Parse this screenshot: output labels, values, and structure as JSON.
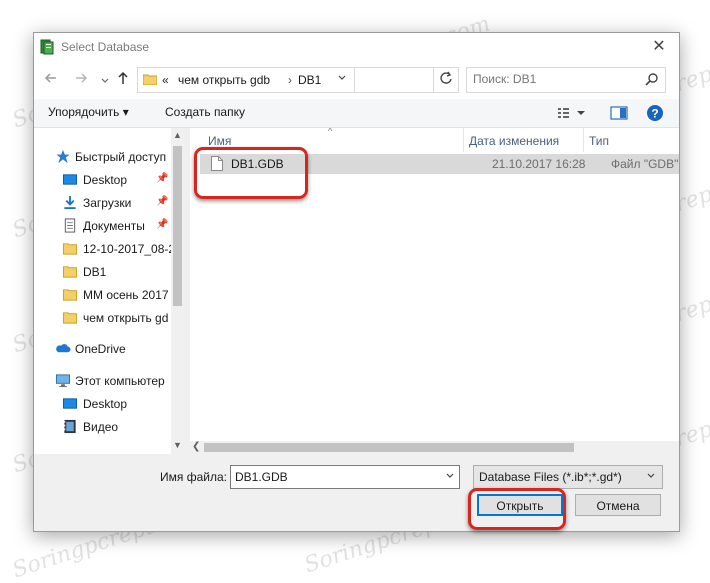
{
  "window": {
    "title": "Select Database",
    "close_glyph": "✕"
  },
  "address": {
    "overflow": "«",
    "crumbs": [
      "чем открыть gdb",
      "DB1"
    ],
    "separator": "›",
    "search_placeholder": "Поиск: DB1"
  },
  "toolbar": {
    "organize_label": "Упорядочить ▾",
    "new_folder_label": "Создать папку"
  },
  "nav": {
    "quick_access": "Быстрый доступ",
    "desktop": "Desktop",
    "downloads": "Загрузки",
    "documents": "Документы",
    "folder1": "12-10-2017_08-2",
    "folder2": "DB1",
    "folder3": "ММ осень 2017",
    "folder4": "чем открыть gd",
    "onedrive": "OneDrive",
    "this_pc": "Этот компьютер",
    "pc_desktop": "Desktop",
    "video": "Видео"
  },
  "columns": {
    "name": "Имя",
    "date": "Дата изменения",
    "type": "Тип"
  },
  "files": [
    {
      "name": "DB1.GDB",
      "date": "21.10.2017 16:28",
      "type": "Файл \"GDB\""
    }
  ],
  "bottom": {
    "filename_label": "Имя файла:",
    "filename_value": "DB1.GDB",
    "filter_value": "Database Files (*.ib*;*.gd*)",
    "open_label": "Открыть",
    "cancel_label": "Отмена"
  },
  "watermark": "Soringpcrepair.com",
  "colors": {
    "accent": "#0078d7",
    "highlight": "#d9251c",
    "selection": "#d9d9d9"
  },
  "icons": [
    "app-icon",
    "close-icon",
    "back-arrow-icon",
    "up-arrow-icon",
    "folder-icon",
    "refresh-icon",
    "search-icon",
    "view-toggle-icon",
    "preview-pane-icon",
    "help-icon",
    "star-icon",
    "desktop-icon",
    "download-icon",
    "documents-icon",
    "pin-icon",
    "onedrive-icon",
    "computer-icon",
    "video-icon",
    "file-icon",
    "chevron-down-icon"
  ]
}
